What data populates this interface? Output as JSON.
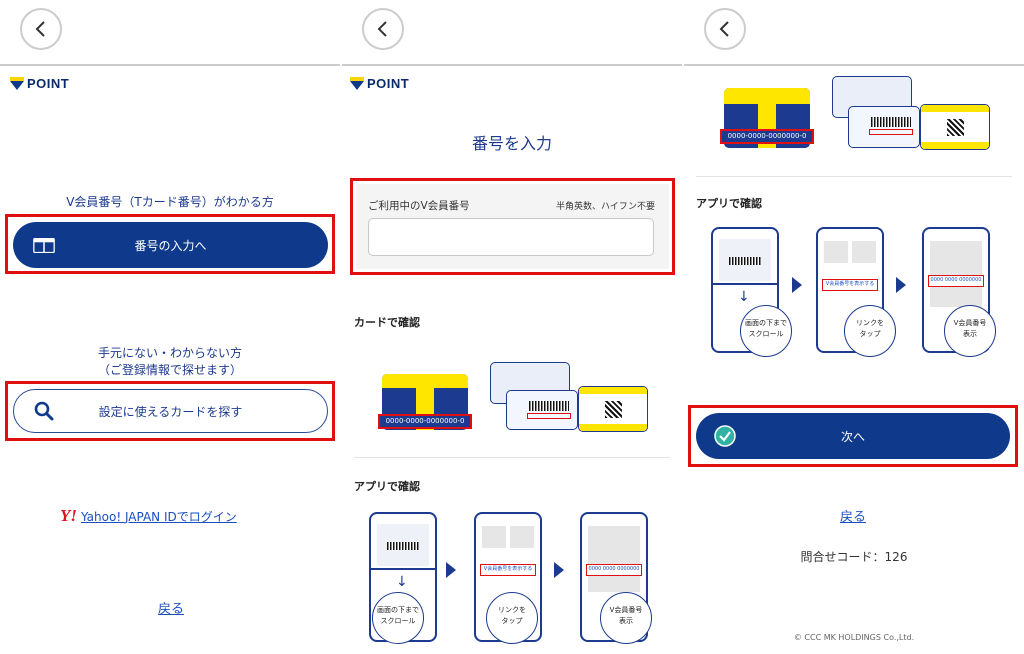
{
  "panel1": {
    "logo": "POINT",
    "know_label": "V会員番号（Tカード番号）がわかる方",
    "enter_number_button": "番号の入力へ",
    "unknown_label_line1": "手元にない・わからない方",
    "unknown_label_line2": "（ご登録情報で探せます）",
    "find_card_button": "設定に使えるカードを探す",
    "yahoo_link": "Yahoo! JAPAN IDでログイン",
    "yahoo_logo": "Y!",
    "back_link": "戻る"
  },
  "panel2": {
    "logo": "POINT",
    "title": "番号を入力",
    "field_label": "ご利用中のV会員番号",
    "field_hint": "半角英数、ハイフン不要",
    "field_value": "",
    "card_heading": "カードで確認",
    "card_number": "0000-0000-0000000-0",
    "app_heading": "アプリで確認",
    "step1": [
      "画面の下まで",
      "スクロール"
    ],
    "step2": [
      "リンクを",
      "タップ"
    ],
    "step3": [
      "V会員番号",
      "表示"
    ],
    "screen_link_text": "V会員番号を表示する",
    "screen_number_text": "0000 0000 0000000 0"
  },
  "panel3": {
    "card_number": "0000-0000-0000000-0",
    "app_heading": "アプリで確認",
    "step1": [
      "画面の下まで",
      "スクロール"
    ],
    "step2": [
      "リンクを",
      "タップ"
    ],
    "step3": [
      "V会員番号",
      "表示"
    ],
    "screen_link_text": "V会員番号を表示する",
    "screen_number_text": "0000 0000 0000000 0",
    "next_button": "次へ",
    "back_link": "戻る",
    "inquiry_code": "問合せコード：126",
    "copyright": "© CCC MK HOLDINGS Co.,Ltd."
  },
  "colors": {
    "brand_navy": "#0f3a8c",
    "highlight_red": "#e01010",
    "card_yellow": "#ffe600",
    "link_blue": "#1a4fc0"
  }
}
